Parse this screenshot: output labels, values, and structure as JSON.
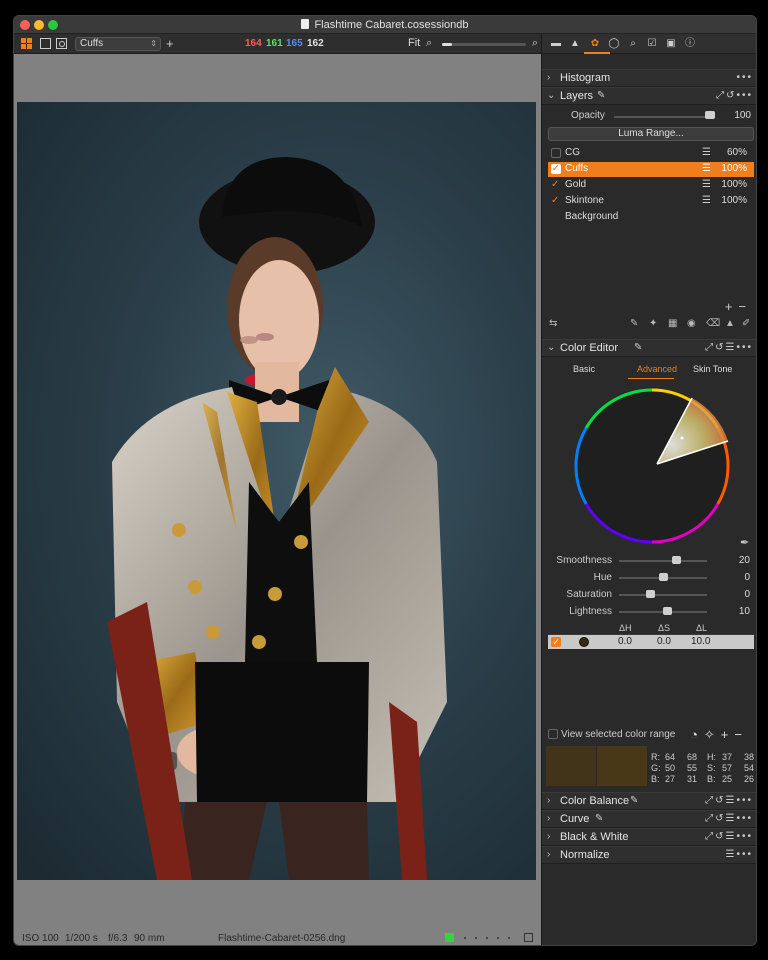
{
  "window": {
    "title": "Flashtime Cabaret.cosessiondb"
  },
  "toolbar": {
    "layer_select": "Cuffs",
    "rgb": {
      "r": "164",
      "g": "161",
      "b": "165",
      "l": "162"
    },
    "fit_label": "Fit",
    "zoom_level": 0.12,
    "colors": {
      "r": "#ff5a5a",
      "g": "#5ee06a",
      "b": "#5a8aff",
      "l": "#e0e0e0"
    }
  },
  "viewer": {
    "status": {
      "iso": "ISO 100",
      "shutter": "1/200 s",
      "aperture": "f/6.3",
      "focal": "90 mm",
      "filename": "Flashtime-Cabaret-0256.dng"
    },
    "color_tag": "#3ad13a",
    "rating_dots": 5
  },
  "tool_tabs": [
    "folder-icon",
    "camera-icon",
    "color-icon",
    "lens-icon",
    "search-icon",
    "checklist-icon",
    "camera-body-icon",
    "info-icon"
  ],
  "sections": {
    "histogram": "Histogram",
    "layers": "Layers",
    "color_editor": "Color Editor",
    "color_balance": "Color Balance",
    "curve": "Curve",
    "black_white": "Black & White",
    "normalize": "Normalize"
  },
  "layers": {
    "opacity_label": "Opacity",
    "opacity_value": "100",
    "luma_button": "Luma Range...",
    "items": [
      {
        "name": "CG",
        "checked": false,
        "opacity": "60%",
        "selected": false
      },
      {
        "name": "Cuffs",
        "checked": true,
        "opacity": "100%",
        "selected": true
      },
      {
        "name": "Gold",
        "checked": true,
        "opacity": "100%",
        "selected": false
      },
      {
        "name": "Skintone",
        "checked": true,
        "opacity": "100%",
        "selected": false
      },
      {
        "name": "Background",
        "checked": false,
        "opacity": "",
        "selected": false
      }
    ]
  },
  "color_editor": {
    "tabs": [
      "Basic",
      "Advanced",
      "Skin Tone"
    ],
    "active_tab": "Advanced",
    "sliders": [
      {
        "label": "Smoothness",
        "value": "20",
        "pos": 0.65
      },
      {
        "label": "Hue",
        "value": "0",
        "pos": 0.5
      },
      {
        "label": "Saturation",
        "value": "0",
        "pos": 0.35
      },
      {
        "label": "Lightness",
        "value": "10",
        "pos": 0.55
      }
    ],
    "table_headers": [
      "ΔH",
      "ΔS",
      "ΔL"
    ],
    "table_row": {
      "dh": "0.0",
      "ds": "0.0",
      "dl": "10.0"
    },
    "view_range_label": "View selected color range",
    "readout": {
      "r_label": "R:",
      "r1": "64",
      "r2": "68",
      "g_label": "G:",
      "g1": "50",
      "g2": "55",
      "b_label": "B:",
      "b1": "27",
      "b2": "31",
      "h_label": "H:",
      "h1": "37",
      "h2": "38",
      "s_label": "S:",
      "s1": "57",
      "s2": "54",
      "b2_label": "B:",
      "bb1": "25",
      "bb2": "26"
    },
    "accent": "#f07e1c"
  }
}
